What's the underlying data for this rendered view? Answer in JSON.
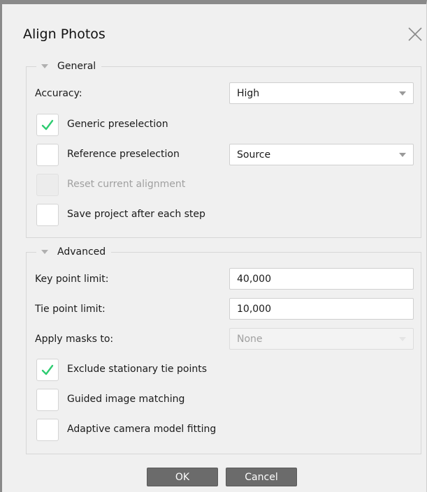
{
  "dialog": {
    "title": "Align Photos",
    "close_icon": "close-icon"
  },
  "general": {
    "legend": "General",
    "accuracy_label": "Accuracy:",
    "accuracy_value": "High",
    "generic_preselection": {
      "label": "Generic preselection",
      "checked": true
    },
    "reference_preselection": {
      "label": "Reference preselection",
      "checked": false,
      "value": "Source"
    },
    "reset_alignment": {
      "label": "Reset current alignment",
      "checked": false,
      "disabled": true
    },
    "save_project": {
      "label": "Save project after each step",
      "checked": false
    }
  },
  "advanced": {
    "legend": "Advanced",
    "key_point_limit_label": "Key point limit:",
    "key_point_limit_value": "40,000",
    "tie_point_limit_label": "Tie point limit:",
    "tie_point_limit_value": "10,000",
    "apply_masks_label": "Apply masks to:",
    "apply_masks_value": "None",
    "exclude_stationary": {
      "label": "Exclude stationary tie points",
      "checked": true
    },
    "guided_matching": {
      "label": "Guided image matching",
      "checked": false
    },
    "adaptive_fitting": {
      "label": "Adaptive camera model fitting",
      "checked": false
    }
  },
  "buttons": {
    "ok": "OK",
    "cancel": "Cancel"
  },
  "colors": {
    "check_mark": "#2ecc71",
    "button_bg": "#6b6b6b",
    "dialog_bg": "#f0f0f0"
  }
}
